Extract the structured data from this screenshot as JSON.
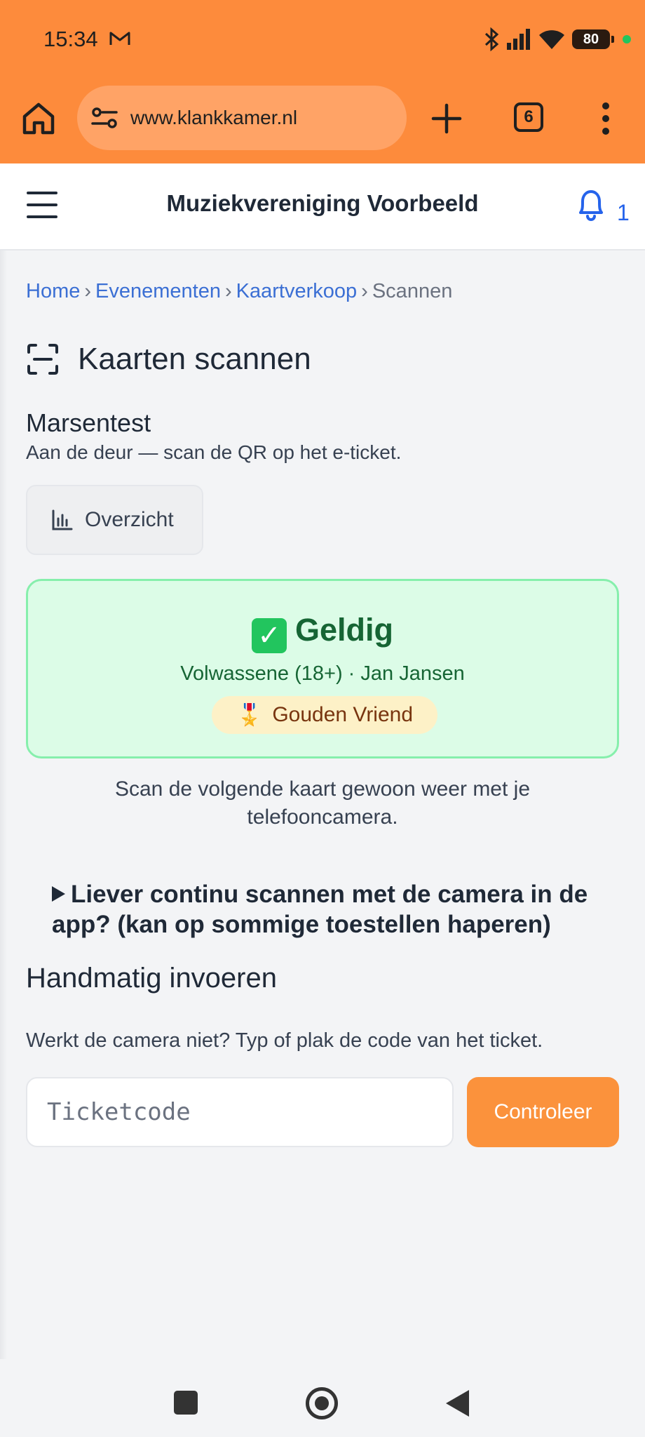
{
  "status_bar": {
    "time": "15:34",
    "battery": "80",
    "icons": [
      "gmail-icon",
      "bluetooth-icon",
      "signal-icon",
      "wifi-icon",
      "battery-icon"
    ]
  },
  "browser": {
    "url": "www.klankkamer.nl",
    "tab_count": "6"
  },
  "header": {
    "title": "Muziekvereniging Voorbeeld",
    "notification_count": "1"
  },
  "breadcrumb": {
    "items": [
      "Home",
      "Evenementen",
      "Kaartverkoop"
    ],
    "current": "Scannen",
    "separator": "›"
  },
  "page": {
    "title": "Kaarten scannen",
    "event_name": "Marsentest",
    "event_subtitle": "Aan de deur — scan de QR op het e-ticket.",
    "overview_label": "Overzicht"
  },
  "result": {
    "status": "Geldig",
    "check_glyph": "✓",
    "detail": "Volwassene (18+) · Jan Jansen",
    "badge_medal": "🎖️",
    "badge": "Gouden Vriend"
  },
  "hint": "Scan de volgende kaart gewoon weer met je telefooncamera.",
  "camera_details": "Liever continu scannen met de camera in de app? (kan op sommige toestellen haperen)",
  "manual": {
    "title": "Handmatig invoeren",
    "subtitle": "Werkt de camera niet? Typ of plak de code van het ticket.",
    "placeholder": "Ticketcode",
    "button_label": "Controleer"
  },
  "colors": {
    "chrome": "#fd8b3c",
    "accent_orange": "#fb923c",
    "link": "#3b6fd4",
    "success_bg": "#dcfce7",
    "success_border": "#86efac",
    "success_text": "#166534",
    "badge_bg": "#fdf1c7"
  }
}
